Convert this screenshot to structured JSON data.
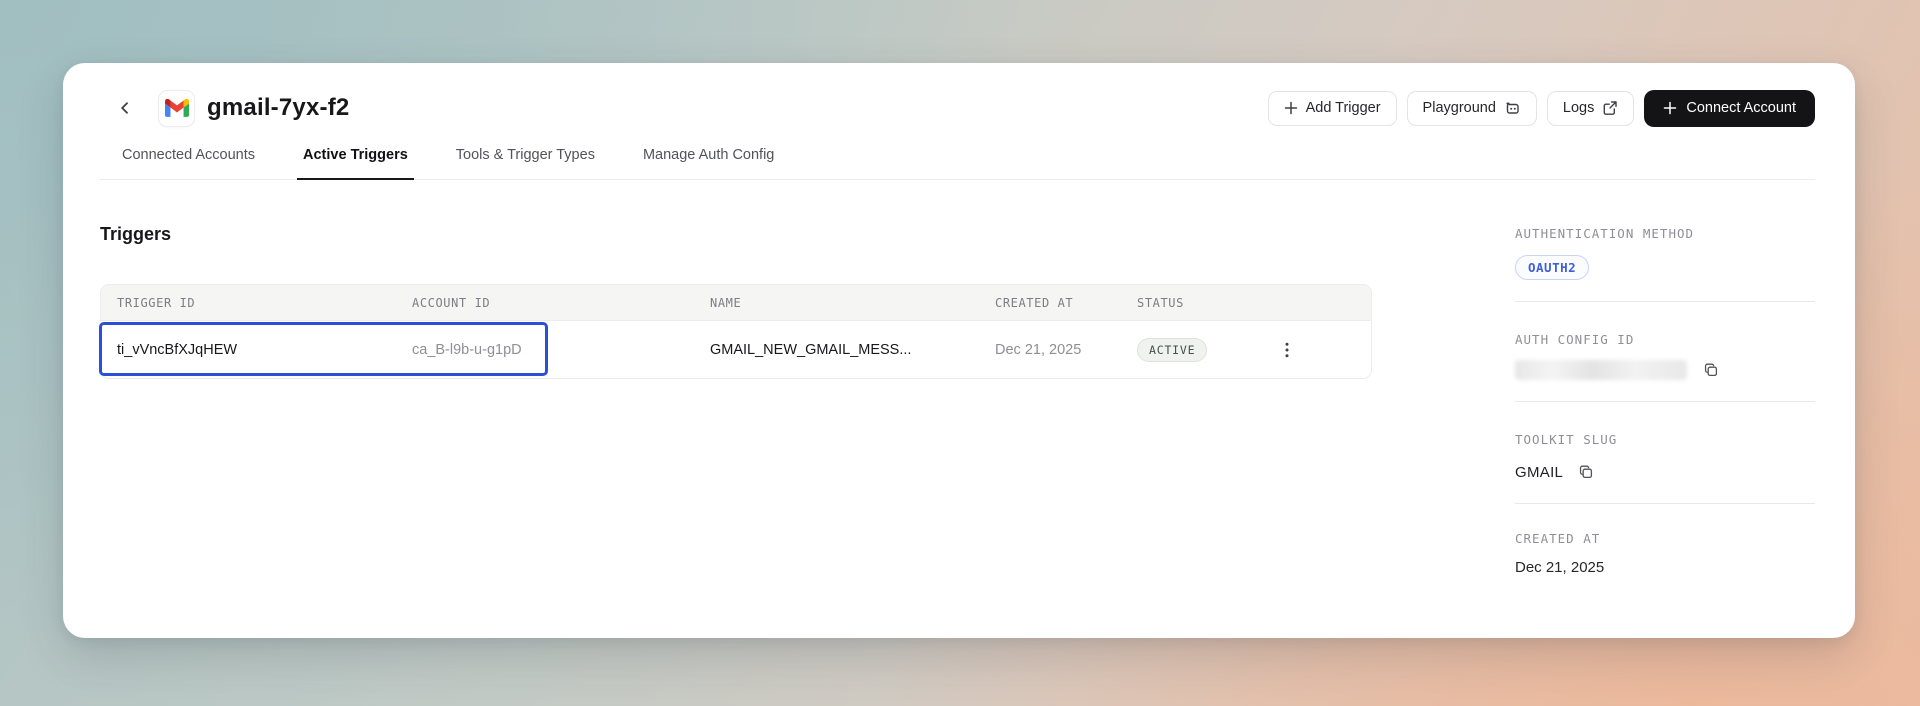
{
  "header": {
    "title": "gmail-7yx-f2",
    "actions": {
      "add_trigger": "Add Trigger",
      "playground": "Playground",
      "logs": "Logs",
      "connect_account": "Connect Account"
    }
  },
  "tabs": [
    {
      "label": "Connected Accounts",
      "active": false
    },
    {
      "label": "Active Triggers",
      "active": true
    },
    {
      "label": "Tools & Trigger Types",
      "active": false
    },
    {
      "label": "Manage Auth Config",
      "active": false
    }
  ],
  "main": {
    "heading": "Triggers",
    "table": {
      "columns": [
        "TRIGGER ID",
        "ACCOUNT ID",
        "NAME",
        "CREATED AT",
        "STATUS"
      ],
      "rows": [
        {
          "trigger_id": "ti_vVncBfXJqHEW",
          "account_id": "ca_B-l9b-u-g1pD",
          "name": "GMAIL_NEW_GMAIL_MESS...",
          "created_at": "Dec 21, 2025",
          "status": "ACTIVE"
        }
      ]
    }
  },
  "sidebar": {
    "auth_method": {
      "label": "AUTHENTICATION METHOD",
      "badge": "OAUTH2"
    },
    "auth_config": {
      "label": "AUTH CONFIG ID",
      "value": "(redacted)"
    },
    "toolkit": {
      "label": "TOOLKIT SLUG",
      "value": "GMAIL"
    },
    "created": {
      "label": "CREATED AT",
      "value": "Dec 21, 2025"
    }
  },
  "colors": {
    "annotation_blue": "#2b4fd9",
    "badge_blue": "#3f5fd8",
    "dark_button": "#141417",
    "active_badge_text": "#44504a"
  }
}
